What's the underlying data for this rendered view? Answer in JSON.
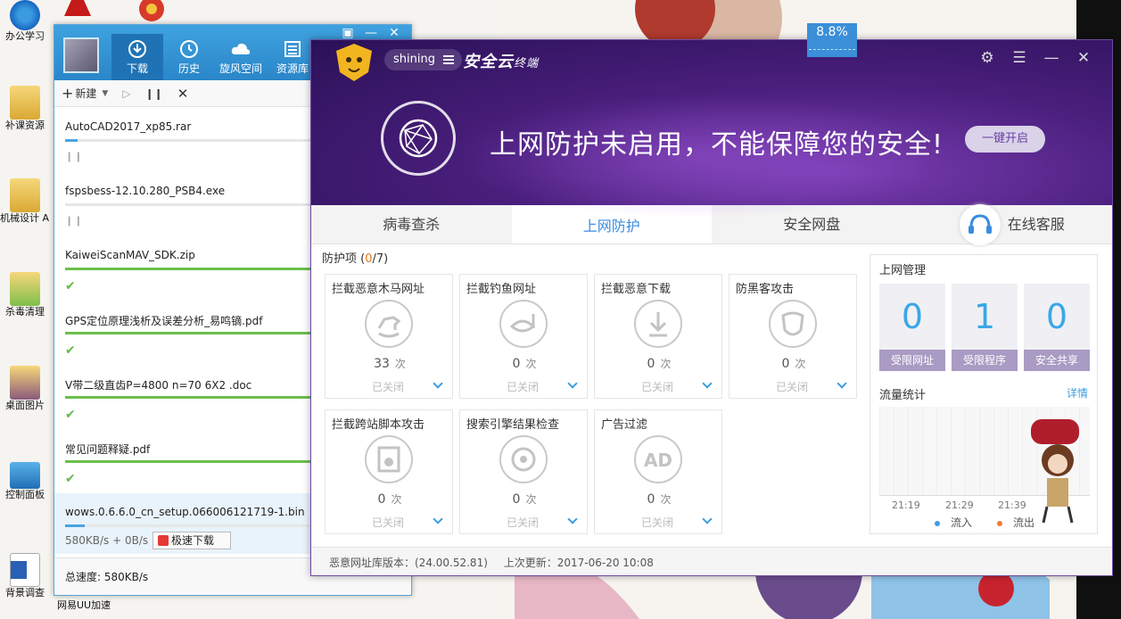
{
  "desktop": {
    "icons": [
      {
        "label": "办公学习"
      },
      {
        "label": "补课资源"
      },
      {
        "label": "机械设计 AD辅助"
      },
      {
        "label": "杀毒清理"
      },
      {
        "label": "桌面图片"
      },
      {
        "label": "控制面板"
      },
      {
        "label": "背景调查"
      }
    ],
    "taskbar_hint": "网易UU加速"
  },
  "download_manager": {
    "tabs": [
      {
        "label": "下载"
      },
      {
        "label": "历史"
      },
      {
        "label": "旋风空间"
      },
      {
        "label": "资源库"
      }
    ],
    "toolbar": {
      "new_label": "新建"
    },
    "items": [
      {
        "name": "AutoCAD2017_xp85.rar",
        "progress": 0.05,
        "state": "paused"
      },
      {
        "name": "fspsbess-12.10.280_PSB4.exe",
        "progress": 0.0,
        "state": "paused"
      },
      {
        "name": "KaiweiScanMAV_SDK.zip",
        "progress": 1.0,
        "state": "done"
      },
      {
        "name": "GPS定位原理浅析及误差分析_易鸣镝.pdf",
        "progress": 1.0,
        "state": "done"
      },
      {
        "name": "V带二级直齿P=4800 n=70 6X2 .doc",
        "progress": 1.0,
        "state": "done"
      },
      {
        "name": "常见问题释疑.pdf",
        "progress": 1.0,
        "state": "done"
      },
      {
        "name": "wows.0.6.6.0_cn_setup.066006121719-1.bin",
        "progress": 0.08,
        "state": "downloading",
        "speed": "580KB/s + 0B/s"
      }
    ],
    "fast_download_label": "极速下载",
    "total_speed": "总速度: 580KB/s"
  },
  "security": {
    "user": "shining",
    "brand": "安全云",
    "brand_suffix": "终端",
    "net_speed": "8.8%",
    "hero_text": "上网防护未启用，不能保障您的安全!",
    "hero_button": "一键开启",
    "tabs": [
      {
        "label": "病毒查杀"
      },
      {
        "label": "上网防护"
      },
      {
        "label": "安全网盘"
      },
      {
        "label": "在线客服"
      }
    ],
    "protect_title_prefix": "防护项 (",
    "protect_count": "0",
    "protect_total": "/7)",
    "cards": [
      {
        "title": "拦截恶意木马网址",
        "count": "33",
        "unit": "次",
        "status": "已关闭"
      },
      {
        "title": "拦截钓鱼网址",
        "count": "0",
        "unit": "次",
        "status": "已关闭"
      },
      {
        "title": "拦截恶意下载",
        "count": "0",
        "unit": "次",
        "status": "已关闭"
      },
      {
        "title": "防黑客攻击",
        "count": "0",
        "unit": "次",
        "status": "已关闭"
      },
      {
        "title": "拦截跨站脚本攻击",
        "count": "0",
        "unit": "次",
        "status": "已关闭"
      },
      {
        "title": "搜索引擎结果检查",
        "count": "0",
        "unit": "次",
        "status": "已关闭"
      },
      {
        "title": "广告过滤",
        "count": "0",
        "unit": "次",
        "status": "已关闭"
      }
    ],
    "management": {
      "title": "上网管理",
      "boxes": [
        {
          "value": "0",
          "label": "受限网址"
        },
        {
          "value": "1",
          "label": "受限程序"
        },
        {
          "value": "0",
          "label": "安全共享"
        }
      ]
    },
    "traffic": {
      "title": "流量统计",
      "more": "详情",
      "times": [
        "21:19",
        "21:29",
        "21:39"
      ],
      "legend_in": "流入",
      "legend_out": "流出"
    },
    "footer": {
      "db_version": "恶意网址库版本：(24.00.52.81)",
      "last_update": "上次更新：2017-06-20 10:08"
    },
    "colors": {
      "accent": "#3b8de0",
      "header": "#4a1f7d",
      "count": "#e47a1a"
    }
  }
}
